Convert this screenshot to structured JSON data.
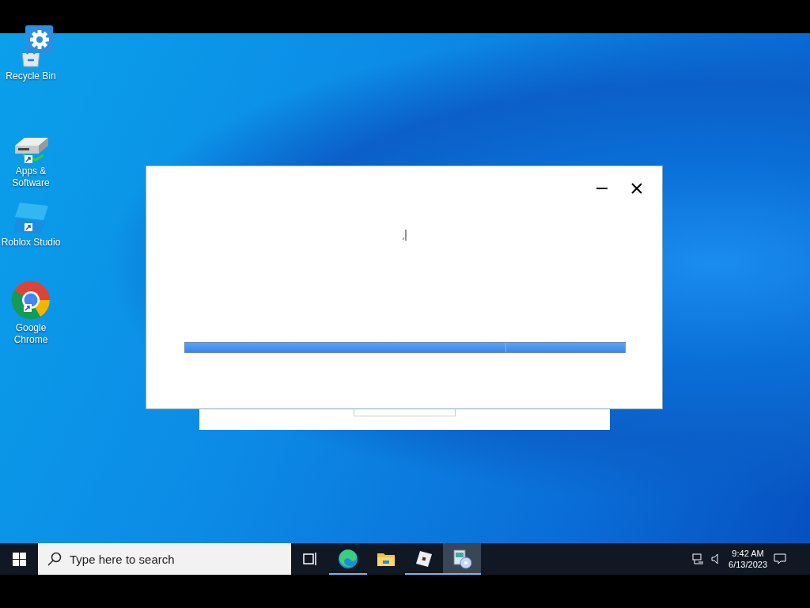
{
  "desktop_icons": [
    {
      "label": "Recycle Bin",
      "kind": "recycle",
      "shortcut": false
    },
    {
      "label": "Apps & Software",
      "kind": "drive",
      "shortcut": true
    },
    {
      "label": "Roblox Studio",
      "kind": "studio",
      "shortcut": true
    },
    {
      "label": "Google Chrome",
      "kind": "chrome",
      "shortcut": true
    }
  ],
  "dialog": {
    "progress": {
      "level": 0.73
    }
  },
  "taskbar": {
    "search": {
      "placeholder": "Type here to search"
    },
    "apps": [
      {
        "kind": "taskview",
        "running": false,
        "selected": false
      },
      {
        "kind": "edge",
        "running": true,
        "selected": false
      },
      {
        "kind": "folder",
        "running": false,
        "selected": false
      },
      {
        "kind": "roblox",
        "running": true,
        "selected": false
      },
      {
        "kind": "installer",
        "running": true,
        "selected": true
      }
    ],
    "clock": {
      "time": "9:42 AM",
      "date": "6/13/2023"
    }
  }
}
